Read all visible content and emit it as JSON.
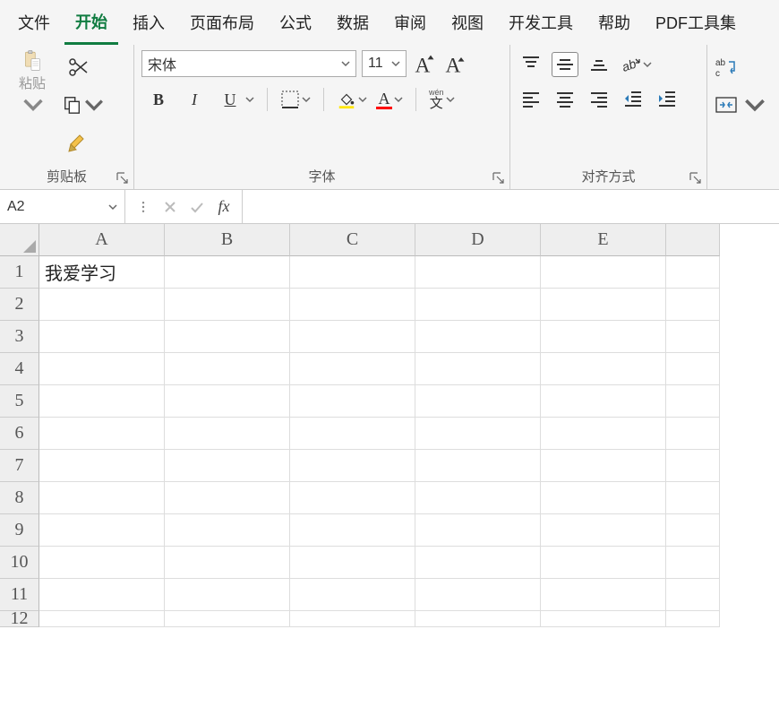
{
  "menu": {
    "items": [
      "文件",
      "开始",
      "插入",
      "页面布局",
      "公式",
      "数据",
      "审阅",
      "视图",
      "开发工具",
      "帮助",
      "PDF工具集"
    ],
    "active_index": 1
  },
  "ribbon": {
    "clipboard": {
      "paste_label": "粘贴",
      "group_label": "剪贴板"
    },
    "font": {
      "name": "宋体",
      "size": "11",
      "group_label": "字体",
      "bold": "B",
      "italic": "I",
      "underline": "U",
      "wen_top": "wén",
      "wen_bottom": "文",
      "font_color_letter": "A"
    },
    "alignment": {
      "group_label": "对齐方式"
    },
    "wrap": {
      "abc": "ab",
      "arrow": "c"
    }
  },
  "formula_bar": {
    "name_box": "A2",
    "fx": "fx",
    "value": ""
  },
  "grid": {
    "columns": [
      "A",
      "B",
      "C",
      "D",
      "E"
    ],
    "rows": [
      1,
      2,
      3,
      4,
      5,
      6,
      7,
      8,
      9,
      10,
      11,
      12
    ],
    "cells": {
      "A1": "我爱学习"
    }
  }
}
